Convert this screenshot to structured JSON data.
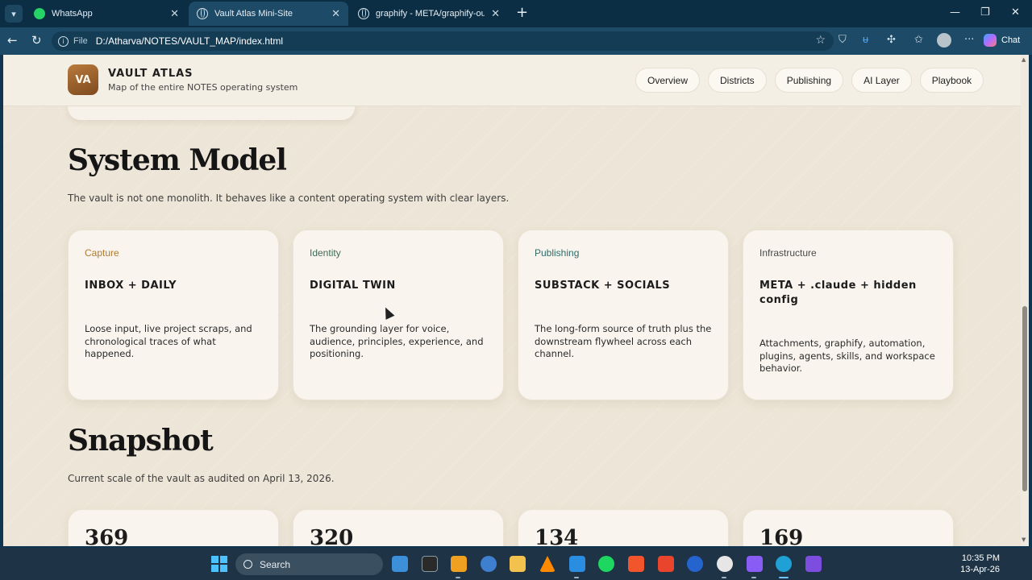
{
  "browser": {
    "tabs": [
      {
        "title": "WhatsApp",
        "icon": "whatsapp-icon",
        "active": false
      },
      {
        "title": "Vault Atlas Mini-Site",
        "icon": "globe-icon",
        "active": true
      },
      {
        "title": "graphify - META/graphify-out/gra",
        "icon": "globe-icon",
        "active": false
      }
    ],
    "address": {
      "scheme_label": "File",
      "url": "D:/Atharva/NOTES/VAULT_MAP/index.html"
    },
    "chat_label": "Chat"
  },
  "site": {
    "logo": "VA",
    "title": "VAULT ATLAS",
    "subtitle": "Map of the entire NOTES operating system",
    "nav": [
      "Overview",
      "Districts",
      "Publishing",
      "AI Layer",
      "Playbook"
    ]
  },
  "system_model": {
    "title": "System Model",
    "description": "The vault is not one monolith. It behaves like a content operating system with clear layers.",
    "cards": [
      {
        "kicker": "Capture",
        "kicker_color": "#b07a30",
        "heading": "INBOX + DAILY",
        "body": "Loose input, live project scraps, and chronological traces of what happened."
      },
      {
        "kicker": "Identity",
        "kicker_color": "#3f6a55",
        "heading": "DIGITAL TWIN",
        "body": "The grounding layer for voice, audience, principles, experience, and positioning."
      },
      {
        "kicker": "Publishing",
        "kicker_color": "#2f6a66",
        "heading": "SUBSTACK + SOCIALS",
        "body": "The long-form source of truth plus the downstream flywheel across each channel."
      },
      {
        "kicker": "Infrastructure",
        "kicker_color": "#4a4a4a",
        "heading": "META + .claude + hidden config",
        "body": "Attachments, graphify, automation, plugins, agents, skills, and workspace behavior."
      }
    ]
  },
  "snapshot": {
    "title": "Snapshot",
    "description": "Current scale of the vault as audited on April 13, 2026.",
    "stats": [
      "369",
      "320",
      "134",
      "169"
    ]
  },
  "taskbar": {
    "search_label": "Search",
    "time": "10:35 PM",
    "date": "13-Apr-26"
  }
}
